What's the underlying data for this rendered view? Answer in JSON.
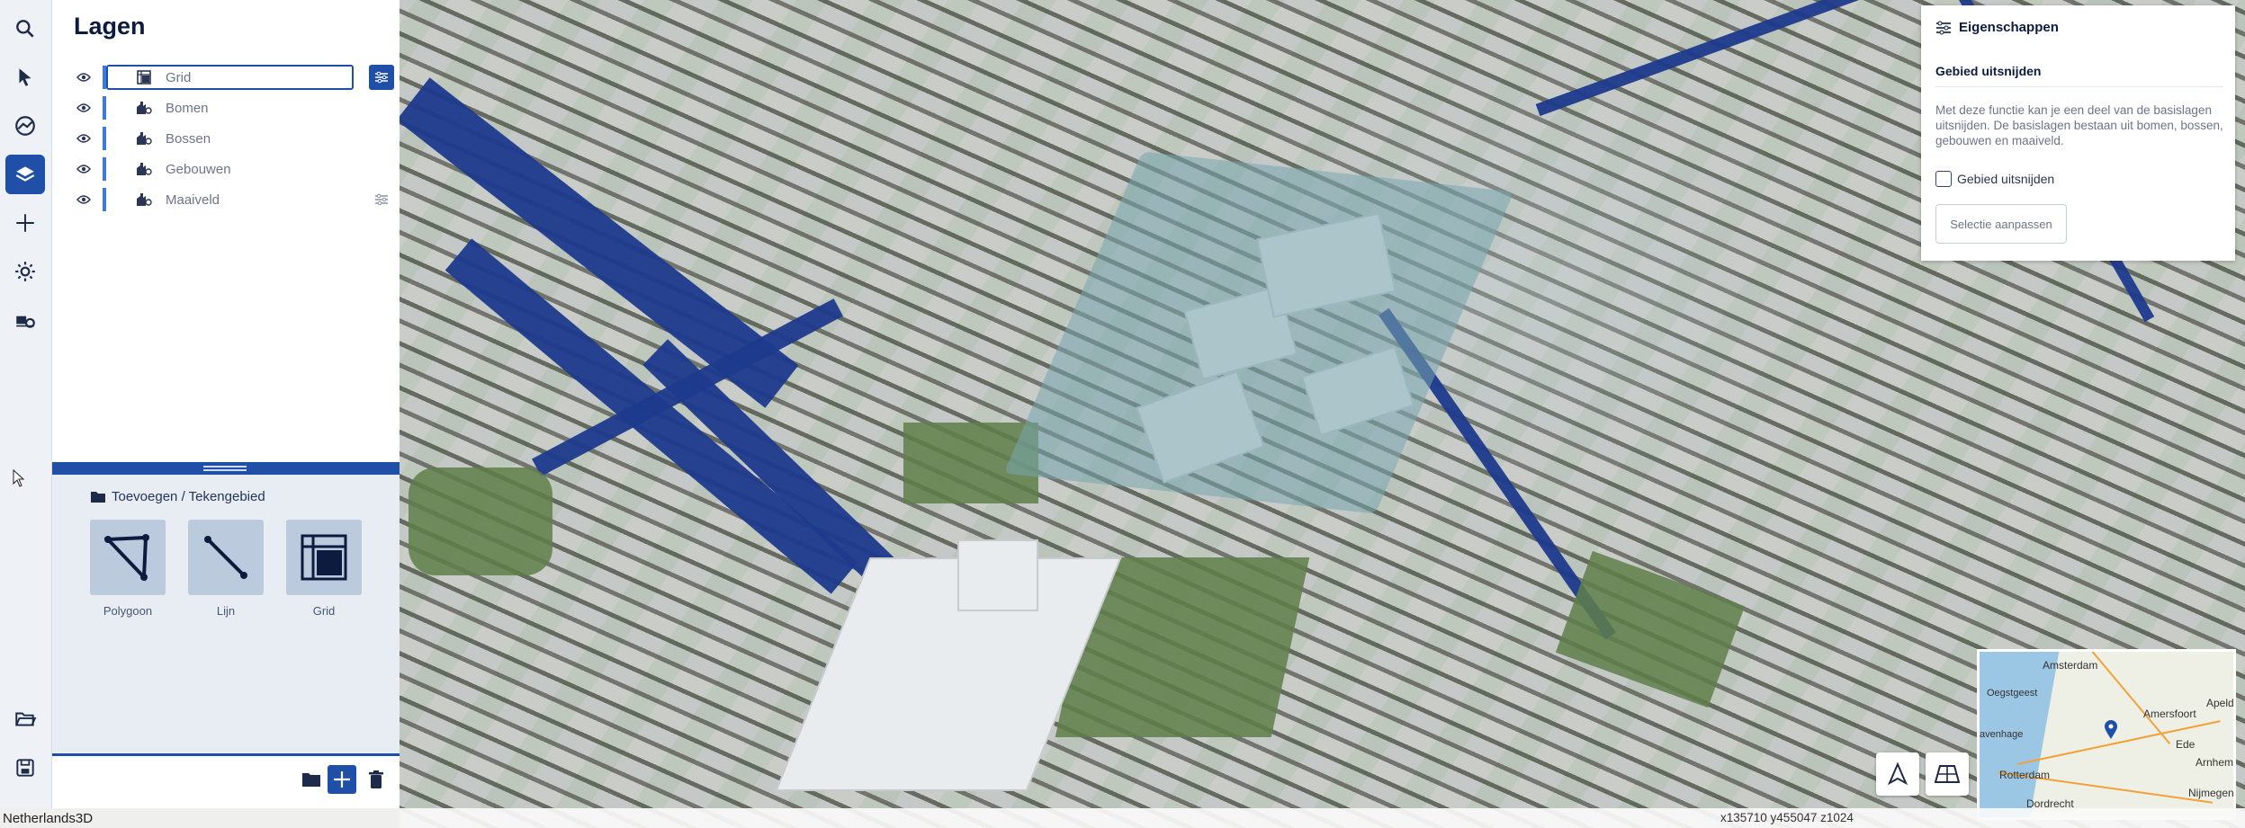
{
  "app": {
    "name": "Netherlands3D"
  },
  "toolbar": {
    "tools": [
      {
        "name": "search-icon"
      },
      {
        "name": "pointer-icon"
      },
      {
        "name": "camera-icon"
      },
      {
        "name": "layers-icon",
        "active": true
      },
      {
        "name": "plus-icon"
      },
      {
        "name": "sun-icon"
      },
      {
        "name": "import-icon"
      },
      {
        "name": "open-folder-icon"
      },
      {
        "name": "save-icon"
      }
    ]
  },
  "layers_panel": {
    "title": "Lagen",
    "layers": [
      {
        "label": "Grid",
        "icon": "grid-layer-icon",
        "selected": true,
        "has_settings": true
      },
      {
        "label": "Bomen",
        "icon": "building-layer-icon"
      },
      {
        "label": "Bossen",
        "icon": "building-layer-icon"
      },
      {
        "label": "Gebouwen",
        "icon": "building-layer-icon"
      },
      {
        "label": "Maaiveld",
        "icon": "building-layer-icon",
        "has_settings": true
      }
    ]
  },
  "add_panel": {
    "title": "Toevoegen / Tekengebied",
    "tools": [
      {
        "label": "Polygoon",
        "icon": "polygon-icon"
      },
      {
        "label": "Lijn",
        "icon": "line-icon"
      },
      {
        "label": "Grid",
        "icon": "grid-icon"
      }
    ]
  },
  "properties": {
    "title": "Eigenschappen",
    "subtitle": "Gebied uitsnijden",
    "description": "Met deze functie kan je een deel van de basislagen uitsnijden. De basislagen bestaan uit bomen, bossen, gebouwen en maaiveld.",
    "checkbox_label": "Gebied uitsnijden",
    "checkbox_checked": false,
    "button_label": "Selectie aanpassen"
  },
  "status": {
    "left": "Netherlands3D",
    "coordinates": "x135710 y455047 z1024"
  },
  "minimap": {
    "cities": [
      "Amsterdam",
      "Oegstgeest",
      "avenhage",
      "Amersfoort",
      "Apeld",
      "Ede",
      "Arnhem",
      "Rotterdam",
      "Dordrecht",
      "Nijmegen"
    ]
  },
  "colors": {
    "accent": "#1f4fa6",
    "water": "#1c3a8c"
  }
}
